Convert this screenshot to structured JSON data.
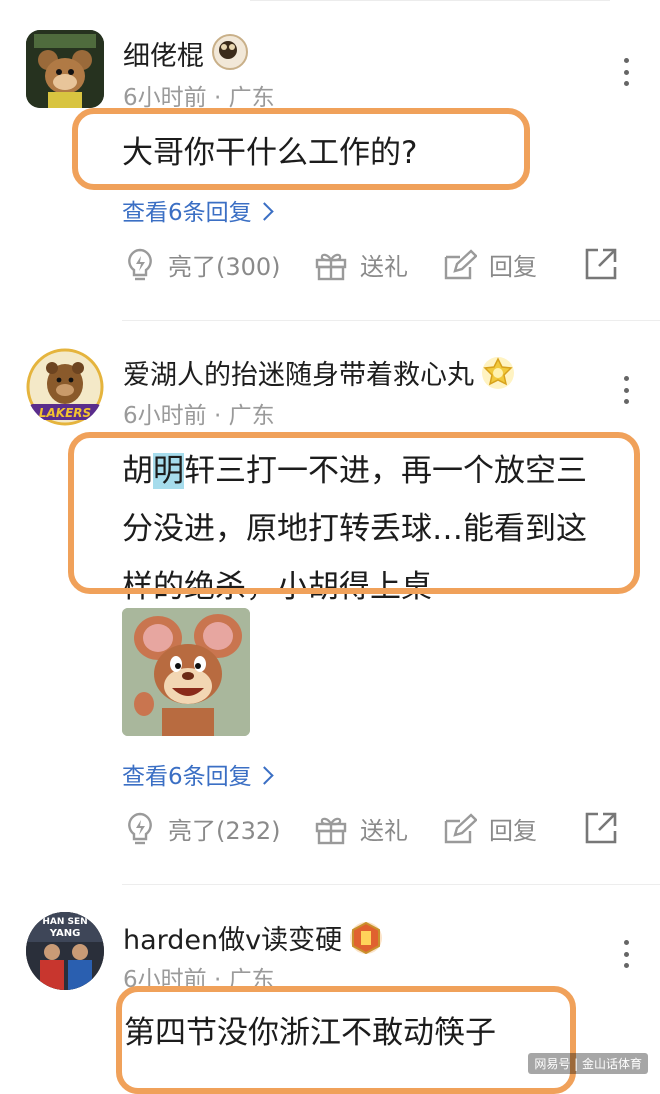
{
  "comments": [
    {
      "username": "细佬棍",
      "meta": "6小时前 · 广东",
      "text_lines": [
        "大哥你干什么工作的?"
      ],
      "replies_label": "查看6条回复",
      "like_label": "亮了(300)",
      "gift_label": "送礼",
      "reply_label": "回复"
    },
    {
      "username": "爱湖人的抬迷随身带着救心丸",
      "meta": "6小时前 · 广东",
      "text_part_1": "胡",
      "text_highlight": "明",
      "text_part_2": "轩三打一不进，再一个放空三",
      "text_line_2": "分没进，原地打转丢球…能看到这",
      "text_line_3": "样的绝杀，小胡得上桌",
      "avatar_text": "LAKERS",
      "replies_label": "查看6条回复",
      "like_label": "亮了(232)",
      "gift_label": "送礼",
      "reply_label": "回复"
    },
    {
      "username": "harden做v读变硬",
      "meta": "6小时前 · 广东",
      "avatar_text_1": "HAN SEN",
      "avatar_text_2": "YANG",
      "text_lines": [
        "第四节没你浙江不敢动筷子"
      ]
    }
  ],
  "watermark": "网易号 | 金山话体育",
  "colors": {
    "outline": "#f0a15a",
    "link": "#3b6fc4",
    "highlight": "#a6dcec",
    "meta": "#9a9a9a"
  },
  "icons": {
    "more": "more-vertical-icon",
    "like": "lightbulb-icon",
    "gift": "gift-icon",
    "reply": "edit-icon",
    "share": "share-icon"
  }
}
